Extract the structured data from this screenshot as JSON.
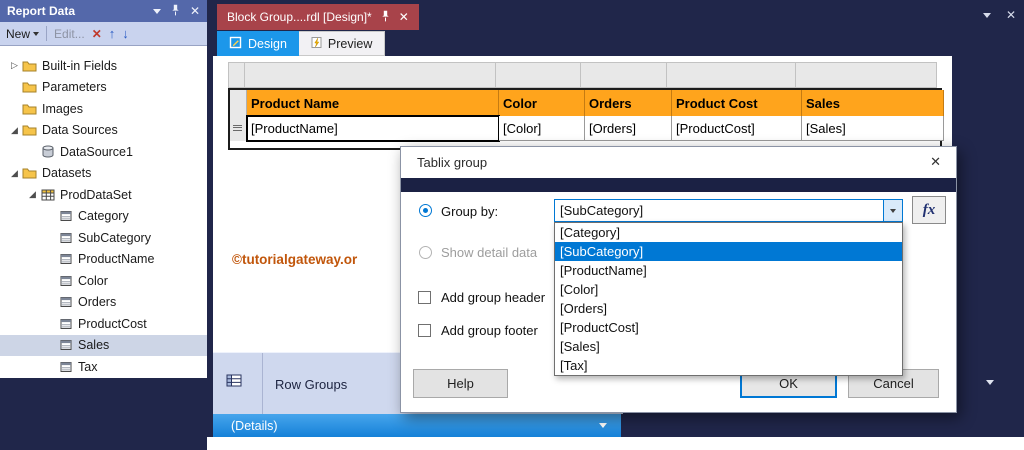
{
  "icons": {
    "close": "✕",
    "delete_x": "✕",
    "up_arrow": "↑",
    "down_arrow": "↓",
    "collapsed_arrow": "▷",
    "expanded_arrow": "◢"
  },
  "window": {
    "document_tab": "Block Group....rdl [Design]*",
    "design_tab": "Design",
    "preview_tab": "Preview"
  },
  "report_data_panel": {
    "title": "Report Data",
    "toolbar": {
      "new": "New",
      "edit": "Edit..."
    },
    "tree": [
      {
        "label": "Built-in Fields",
        "icon": "folder",
        "state": "collapsed"
      },
      {
        "label": "Parameters",
        "icon": "folder"
      },
      {
        "label": "Images",
        "icon": "folder"
      },
      {
        "label": "Data Sources",
        "icon": "folder",
        "state": "expanded"
      },
      {
        "label": "DataSource1",
        "icon": "database"
      },
      {
        "label": "Datasets",
        "icon": "folder",
        "state": "expanded"
      },
      {
        "label": "ProdDataSet",
        "icon": "table",
        "state": "expanded"
      },
      {
        "label": "Category",
        "icon": "field"
      },
      {
        "label": "SubCategory",
        "icon": "field"
      },
      {
        "label": "ProductName",
        "icon": "field"
      },
      {
        "label": "Color",
        "icon": "field"
      },
      {
        "label": "Orders",
        "icon": "field"
      },
      {
        "label": "ProductCost",
        "icon": "field"
      },
      {
        "label": "Sales",
        "icon": "field",
        "selected": true
      },
      {
        "label": "Tax",
        "icon": "field"
      }
    ]
  },
  "designer": {
    "table": {
      "headers": [
        "Product Name",
        "Color",
        "Orders",
        "Product Cost",
        "Sales"
      ],
      "cells": [
        "[ProductName]",
        "[Color]",
        "[Orders]",
        "[ProductCost]",
        "[Sales]"
      ]
    },
    "watermark": "©tutorialgateway.or"
  },
  "grouping_pane": {
    "row_groups": "Row Groups",
    "details": "(Details)"
  },
  "dialog": {
    "title": "Tablix group",
    "group_by": "Group by:",
    "expression_value": "[SubCategory]",
    "fx": "fx",
    "show_detail": "Show detail data",
    "add_header": "Add group header",
    "add_footer": "Add group footer",
    "items": [
      "[Category]",
      "[SubCategory]",
      "[ProductName]",
      "[Color]",
      "[Orders]",
      "[ProductCost]",
      "[Sales]",
      "[Tax]"
    ],
    "selected_item": "[SubCategory]",
    "help": "Help",
    "ok": "OK",
    "cancel": "Cancel"
  },
  "colors": {
    "accent_blue": "#0078d4",
    "table_header_orange": "#ffa41c",
    "document_tab_red": "#a8434a",
    "details_bar_blue": "#1b8ce8",
    "app_background": "#20264a",
    "watermark_orange": "#c1560b"
  }
}
